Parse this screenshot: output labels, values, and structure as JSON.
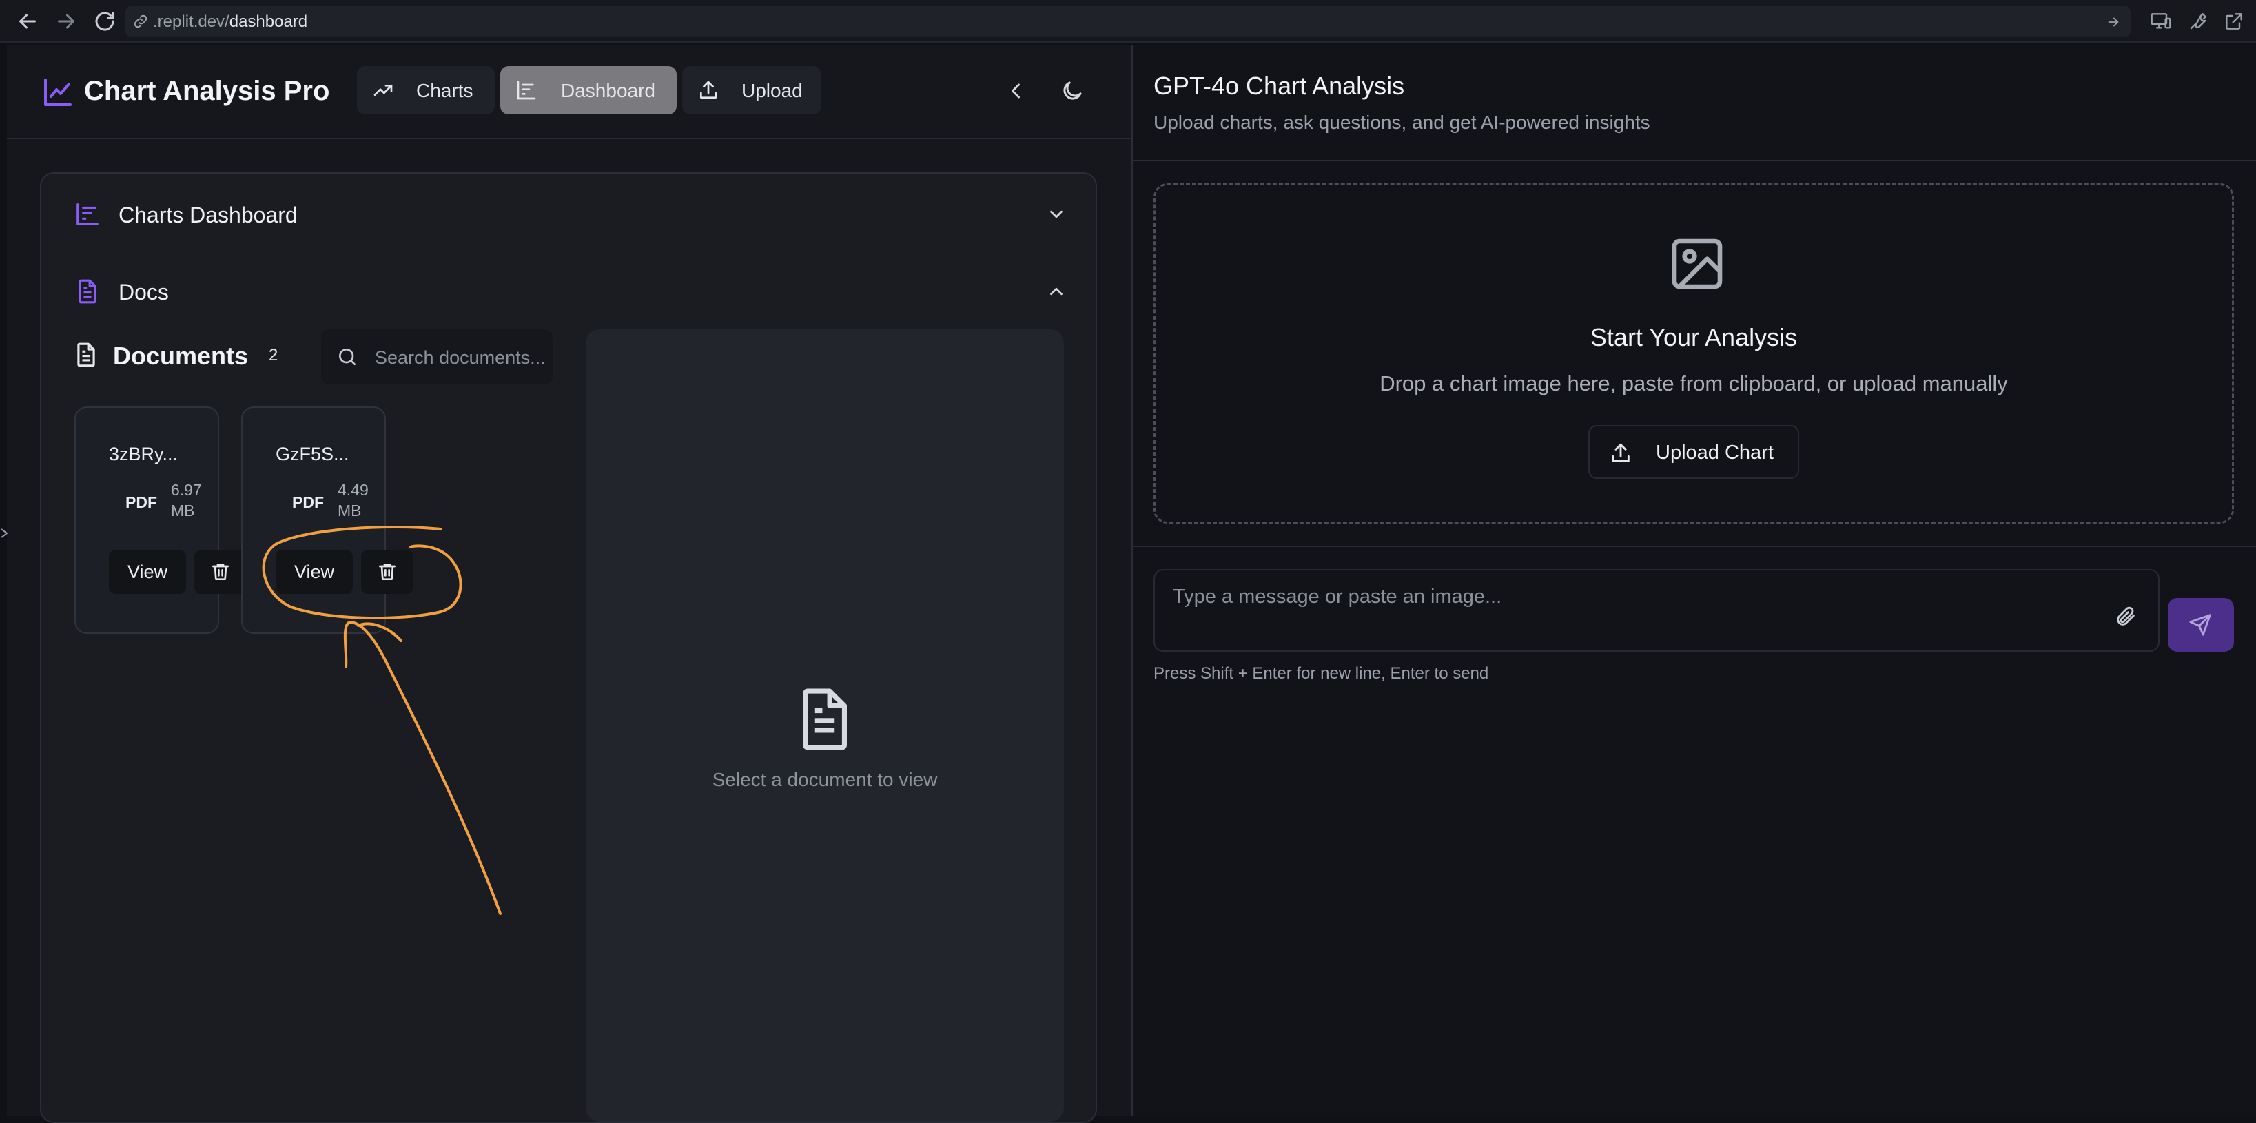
{
  "browser": {
    "url_prefix": ".replit.dev/",
    "url_path": "dashboard",
    "icons": [
      "back-icon",
      "forward-icon",
      "reload-icon",
      "link-icon",
      "forward-arrow-icon",
      "devices-icon",
      "wrench-icon",
      "open-external-icon"
    ]
  },
  "app": {
    "title": "Chart Analysis Pro",
    "tabs": [
      {
        "label": "Charts",
        "icon": "trending-up-icon",
        "active": false
      },
      {
        "label": "Dashboard",
        "icon": "bar-chart-icon",
        "active": true
      },
      {
        "label": "Upload",
        "icon": "upload-icon",
        "active": false
      }
    ],
    "accent_color": "#8b5cf6"
  },
  "left_panel": {
    "sections": [
      {
        "label": "Charts Dashboard",
        "icon": "bar-chart-icon",
        "expanded": false
      },
      {
        "label": "Docs",
        "icon": "document-icon",
        "expanded": true
      }
    ],
    "documents": {
      "title": "Documents",
      "count": "2",
      "search_placeholder": "Search documents...",
      "items": [
        {
          "name": "3zBRy...",
          "type": "PDF",
          "size": "6.97 MB",
          "view_label": "View"
        },
        {
          "name": "GzF5S...",
          "type": "PDF",
          "size": "4.49 MB",
          "view_label": "View"
        }
      ]
    },
    "viewer": {
      "empty_text": "Select a document to view"
    }
  },
  "right_panel": {
    "title": "GPT-4o Chart Analysis",
    "subtitle": "Upload charts, ask questions, and get AI-powered insights",
    "dropzone": {
      "title": "Start Your Analysis",
      "text": "Drop a chart image here, paste from clipboard, or upload manually",
      "button_label": "Upload Chart"
    },
    "message": {
      "placeholder": "Type a message or paste an image...",
      "hint": "Press Shift + Enter for new line, Enter to send"
    },
    "send_color": "#4c2f8a"
  },
  "annotation_color": "#f0a040"
}
